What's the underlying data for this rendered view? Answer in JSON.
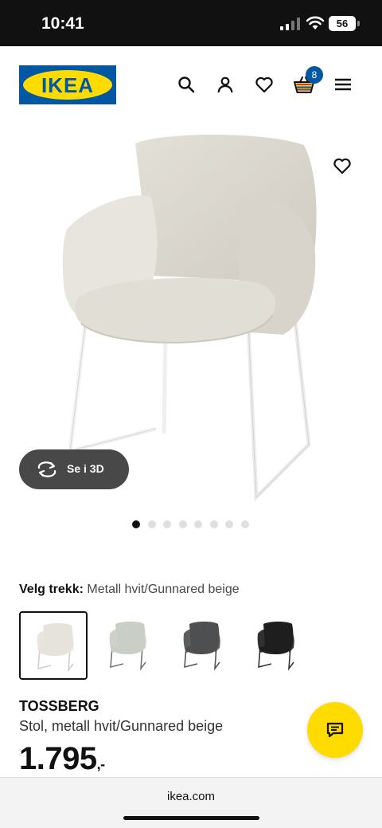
{
  "status_bar": {
    "time": "10:41",
    "battery": "56"
  },
  "header": {
    "logo_text": "IKEA",
    "icons": [
      "search-icon",
      "account-icon",
      "favourites-icon",
      "cart-icon",
      "menu-icon"
    ],
    "cart_count": "8"
  },
  "product_image": {
    "view_3d_label": "Se i 3D",
    "image_count": 8,
    "active_index": 0
  },
  "selection": {
    "label": "Velg trekk:",
    "value": "Metall hvit/Gunnared beige",
    "variants": [
      {
        "color": "#e6e3dc",
        "leg": "#ffffff",
        "selected": true
      },
      {
        "color": "#c9cfc6",
        "leg": "#777777",
        "selected": false
      },
      {
        "color": "#4e4f51",
        "leg": "#555555",
        "selected": false
      },
      {
        "color": "#1e1e1e",
        "leg": "#333333",
        "selected": false
      }
    ]
  },
  "product": {
    "name": "TOSSBERG",
    "description": "Stol, metall hvit/Gunnared beige",
    "price": "1.795",
    "price_suffix": ",-"
  },
  "browser": {
    "url": "ikea.com"
  },
  "colors": {
    "ikea_blue": "#0058a3",
    "ikea_yellow": "#ffdb00"
  }
}
